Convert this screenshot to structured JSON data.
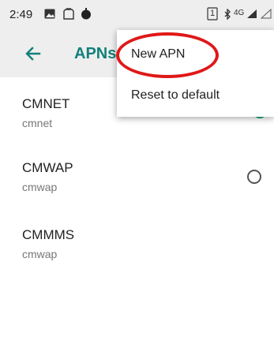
{
  "status_bar": {
    "time": "2:49",
    "icons": [
      "image-icon",
      "clipboard-icon",
      "notification-dot-icon",
      "sim-1-icon",
      "bluetooth-icon",
      "signal-4g-icon",
      "battery-icon"
    ],
    "network_label": "4G",
    "sim_label": "1"
  },
  "app_bar": {
    "title": "APNs",
    "back_icon": "arrow-left-icon"
  },
  "menu": {
    "items": [
      {
        "label": "New APN"
      },
      {
        "label": "Reset to default"
      }
    ]
  },
  "apn_list": [
    {
      "name": "CMNET",
      "apn": "cmnet",
      "selected": true
    },
    {
      "name": "CMWAP",
      "apn": "cmwap",
      "selected": false
    },
    {
      "name": "CMMMS",
      "apn": "cmwap",
      "selected": false
    }
  ],
  "colors": {
    "accent": "#13807a",
    "radio_selected": "#1aa37a",
    "annotation_ring": "#e01818",
    "bar_background": "#eeeeee"
  }
}
